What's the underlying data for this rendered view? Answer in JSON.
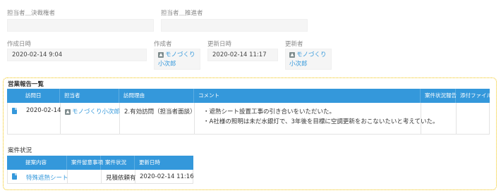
{
  "fields": {
    "kessai_label": "担当者＿決裁権者",
    "suishin_label": "担当者＿推進者",
    "created_label": "作成日時",
    "created_value": "2020-02-14 9:04",
    "creator_label": "作成者",
    "creator_name_1": "モノづくり",
    "creator_name_2": "小次郎",
    "updated_label": "更新日時",
    "updated_value": "2020-02-14 11:17",
    "updater_label": "更新者",
    "updater_name_1": "モノづくり",
    "updater_name_2": "小次郎"
  },
  "sales_report": {
    "title": "営業報告一覧",
    "columns": [
      "訪問日",
      "担当者",
      "訪問理由",
      "コメント",
      "案件状況報告",
      "添付ファイル"
    ],
    "row": {
      "date": "2020-02-14",
      "person": "モノづくり小次郎",
      "reason": "2.有効訪問（担当者面談）",
      "comment_1": "・遮熱シート設置工事の引き合いをいただいた。",
      "comment_2": "・A社様の照明は未だ水銀灯で、3年後を目標に空調更新をおこないたいと考えていた。"
    }
  },
  "case_status": {
    "title": "案件状況",
    "columns": [
      "提案内容",
      "案件留意事項",
      "案件状況",
      "更新日時"
    ],
    "row": {
      "proposal": "特殊遮熱シート",
      "notes": "",
      "status": "見積依頼有",
      "updated": "2020-02-14 11:16"
    }
  },
  "colors": {
    "accent": "#3498db",
    "section_border": "#f1c40f"
  },
  "icons": {
    "user": "user-badge-icon",
    "document": "document-icon"
  }
}
